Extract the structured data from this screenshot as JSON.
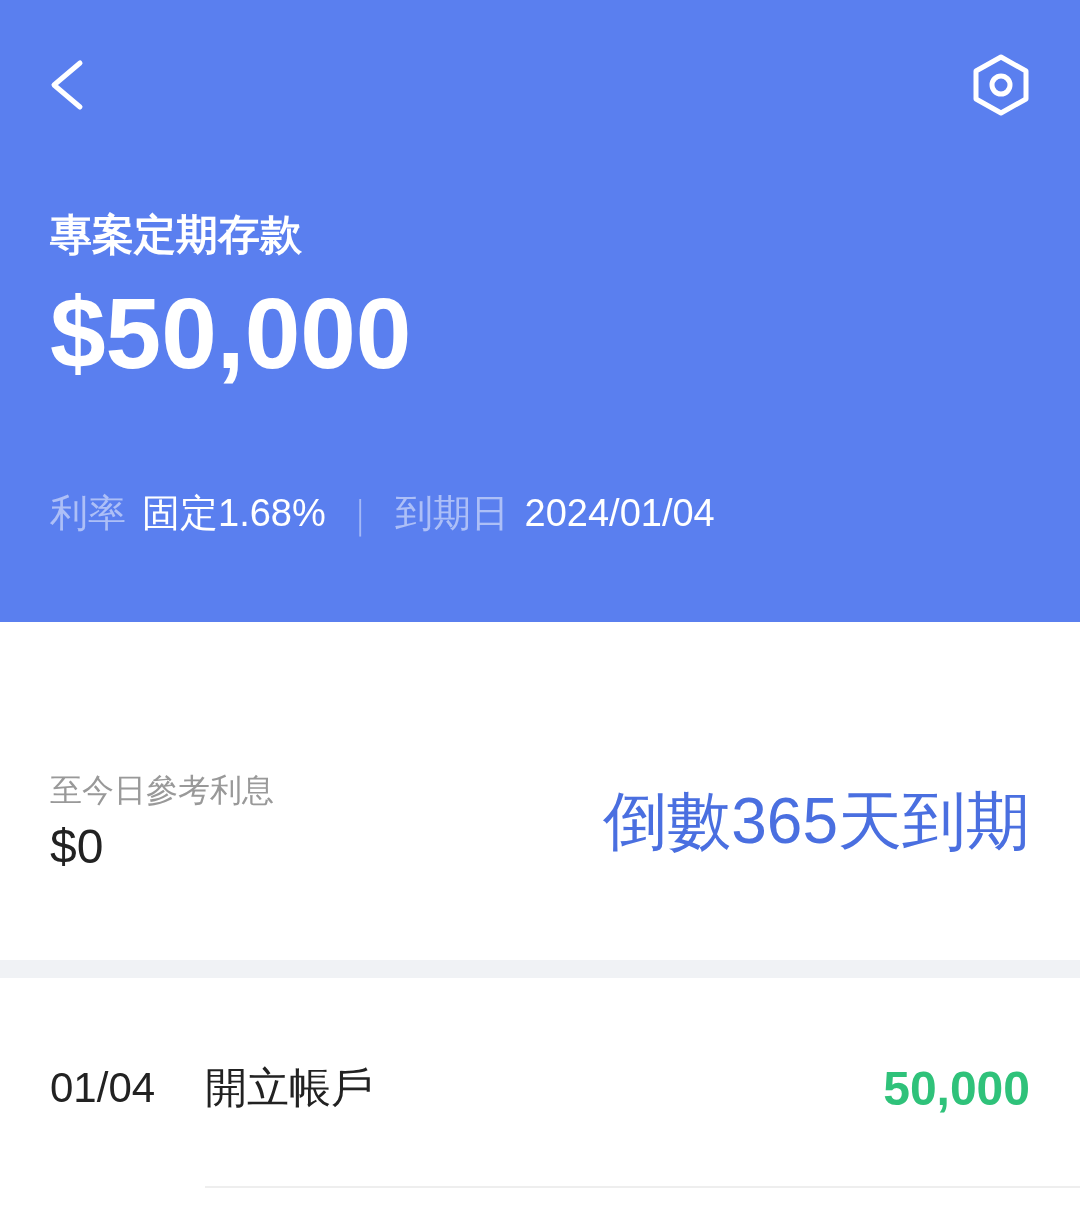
{
  "header": {
    "title": "專案定期存款",
    "amount": "$50,000",
    "rate_label": "利率",
    "rate_value": "固定1.68%",
    "separator": "|",
    "maturity_label": "到期日",
    "maturity_value": "2024/01/04"
  },
  "summary": {
    "interest_label": "至今日參考利息",
    "interest_value": "$0",
    "countdown": "倒數365天到期"
  },
  "transactions": [
    {
      "date": "01/04",
      "description": "開立帳戶",
      "amount": "50,000",
      "kind": "credit"
    }
  ]
}
